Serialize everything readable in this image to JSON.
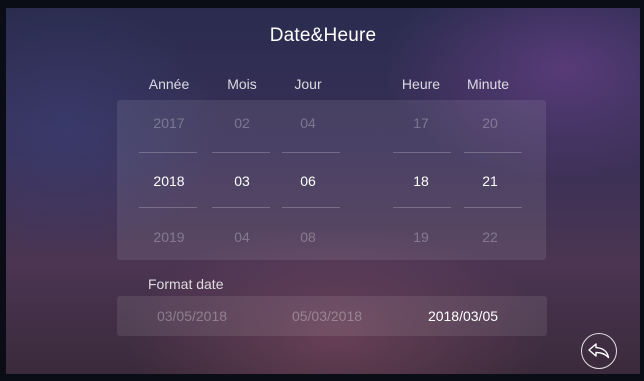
{
  "title": "Date&Heure",
  "columns": [
    {
      "label": "Année",
      "prev": "2017",
      "current": "2018",
      "next": "2019"
    },
    {
      "label": "Mois",
      "prev": "02",
      "current": "03",
      "next": "04"
    },
    {
      "label": "Jour",
      "prev": "04",
      "current": "06",
      "next": "08"
    },
    {
      "label": "Heure",
      "prev": "17",
      "current": "18",
      "next": "19"
    },
    {
      "label": "Minute",
      "prev": "20",
      "current": "21",
      "next": "22"
    }
  ],
  "format": {
    "label": "Format date",
    "options": [
      "03/05/2018",
      "05/03/2018",
      "2018/03/05"
    ],
    "selected": "2018/03/05"
  },
  "back_button": {
    "icon": "reply-arrow-icon"
  },
  "colors": {
    "text": "#ffffff",
    "dim_text": "rgba(255,255,255,0.28)"
  }
}
